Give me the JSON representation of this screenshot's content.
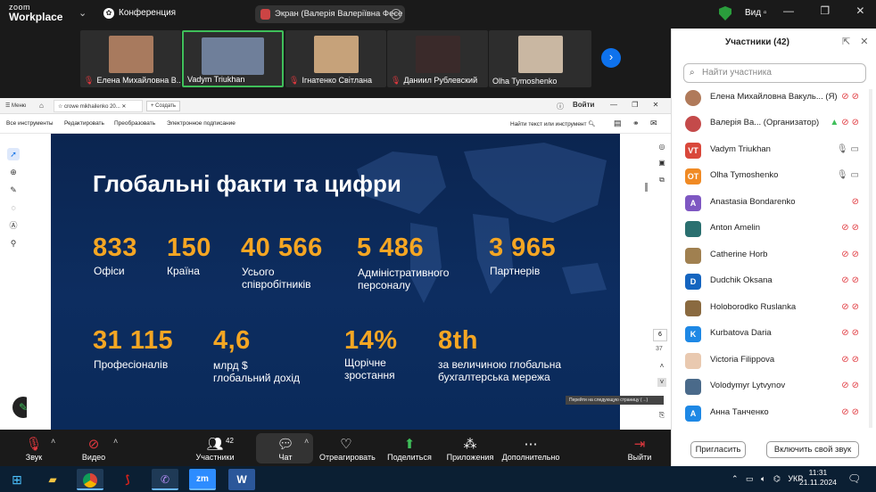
{
  "app": {
    "logo_line1": "zoom",
    "logo_line2": "Workplace",
    "conference": "Конференция",
    "screen_share": "Экран (Валерія Валеріївна Фесе",
    "view": "Вид"
  },
  "thumbnails": [
    {
      "name": "Елена Михайловна В...",
      "muted": true
    },
    {
      "name": "Vadym Triukhan",
      "muted": false,
      "active": true
    },
    {
      "name": "Ігнатенко Світлана",
      "muted": true
    },
    {
      "name": "Даниил Рублевский",
      "muted": true
    },
    {
      "name": "Olha Tymoshenko",
      "muted": false
    }
  ],
  "pdf": {
    "tab_menu": "Меню",
    "tab_doc": "crowe mikhailenko 20...",
    "tab_new": "Создать",
    "signin": "Войти",
    "tools": [
      "Все инструменты",
      "Редактировать",
      "Преобразовать",
      "Электронное подписание"
    ],
    "search": "Найти текст или инструмент",
    "page_current": "6",
    "page_total": "37",
    "tooltip": "Перейти на следующую страницу (→)"
  },
  "slide": {
    "title": "Глобальні факти та цифри",
    "stats": [
      {
        "value": "833",
        "label": "Офіси"
      },
      {
        "value": "150",
        "label": "Країна"
      },
      {
        "value": "40 566",
        "label": "Усього\nспівробітників"
      },
      {
        "value": "5 486",
        "label": "Адміністративного\nперсоналу"
      },
      {
        "value": "3 965",
        "label": "Партнерів"
      },
      {
        "value": "31 115",
        "label": "Професіоналів"
      },
      {
        "value": "4,6",
        "label": "млрд $\nглобальний дохід"
      },
      {
        "value": "14%",
        "label": "Щорічне\nзростання"
      },
      {
        "value": "8th",
        "label": "за величиною глобальна\nбухгалтерська мережа"
      }
    ]
  },
  "toolbar": {
    "audio": "Звук",
    "video": "Видео",
    "participants": "Участники",
    "participants_count": "42",
    "chat": "Чат",
    "react": "Отреагировать",
    "share": "Поделиться",
    "apps": "Приложения",
    "more": "Дополнительно",
    "leave": "Выйти"
  },
  "panel": {
    "title": "Участники (42)",
    "search_placeholder": "Найти участника",
    "invite": "Пригласить",
    "unmute_all": "Включить свой звук",
    "participants": [
      {
        "initials": "",
        "name": "Елена Михайловна Вакуль... (Я)",
        "color": "#b07a5a"
      },
      {
        "initials": "",
        "name": "Валерія Ва...  (Организатор)",
        "color": "#c44a4a"
      },
      {
        "initials": "VT",
        "name": "Vadym Triukhan",
        "color": "#d9483b"
      },
      {
        "initials": "OT",
        "name": "Olha Tymoshenko",
        "color": "#f08a24"
      },
      {
        "initials": "A",
        "name": "Anastasia Bondarenko",
        "color": "#7e57c2"
      },
      {
        "initials": "",
        "name": "Anton Amelin",
        "color": "#2a6f6f"
      },
      {
        "initials": "",
        "name": "Catherine Horb",
        "color": "#a08050"
      },
      {
        "initials": "D",
        "name": "Dudchik Oksana",
        "color": "#1565c0"
      },
      {
        "initials": "",
        "name": "Holoborodko Ruslanka",
        "color": "#8a6a40"
      },
      {
        "initials": "K",
        "name": "Kurbatova Daria",
        "color": "#1e88e5"
      },
      {
        "initials": "",
        "name": "Victoria Filippova",
        "color": "#e9c9b0"
      },
      {
        "initials": "",
        "name": "Volodymyr Lytvynov",
        "color": "#4a6a8a"
      },
      {
        "initials": "A",
        "name": "Анна Танченко",
        "color": "#1e88e5"
      }
    ]
  },
  "taskbar": {
    "lang": "УКР",
    "time": "11:31",
    "date": "21.11.2024"
  }
}
